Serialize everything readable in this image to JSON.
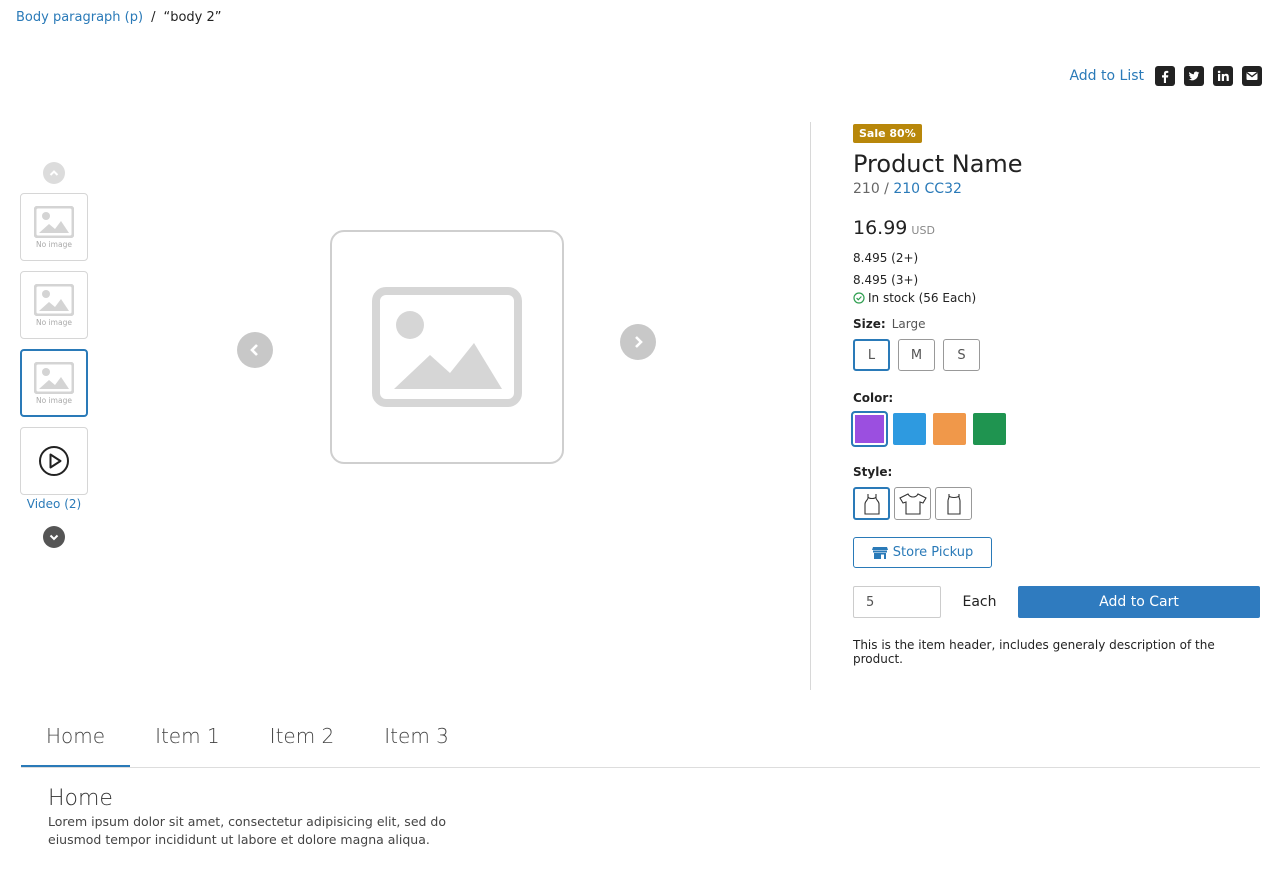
{
  "breadcrumb": {
    "parent": "Body paragraph (p)",
    "separator": "/",
    "current": "“body 2”"
  },
  "share": {
    "add_to_list": "Add to List",
    "icons": [
      "facebook-icon",
      "twitter-icon",
      "linkedin-icon",
      "email-icon"
    ]
  },
  "gallery": {
    "thumbnails": [
      {
        "label": "No image",
        "active": false
      },
      {
        "label": "No image",
        "active": false
      },
      {
        "label": "No image",
        "active": true
      }
    ],
    "video_label": "Video (2)"
  },
  "product": {
    "badge": "Sale 80%",
    "name": "Product Name",
    "sku_prefix": "210 /",
    "sku_link": "210 CC32",
    "price": "16.99",
    "currency": "USD",
    "tiers": [
      "8.495 (2+)",
      "8.495 (3+)"
    ],
    "stock": "In stock (56 Each)",
    "size": {
      "label": "Size:",
      "value": "Large",
      "options": [
        "L",
        "M",
        "S"
      ]
    },
    "color": {
      "label": "Color:",
      "swatches": [
        "#9b4fe0",
        "#2e9ae0",
        "#f0984a",
        "#1f9450"
      ]
    },
    "style": {
      "label": "Style:"
    },
    "store_pickup": "Store Pickup",
    "quantity": "5",
    "uom": "Each",
    "add_to_cart": "Add to Cart",
    "header_desc": "This is the item header, includes generaly description of the product."
  },
  "tabs": {
    "items": [
      "Home",
      "Item 1",
      "Item 2",
      "Item 3"
    ],
    "panel_title": "Home",
    "panel_text": "Lorem ipsum dolor sit amet, consectetur adipisicing elit, sed do eiusmod tempor incididunt ut labore et dolore magna aliqua."
  },
  "colors": {
    "accent": "#2a7ab8",
    "badge": "#b8870a",
    "cart_button": "#2f7bbf"
  }
}
